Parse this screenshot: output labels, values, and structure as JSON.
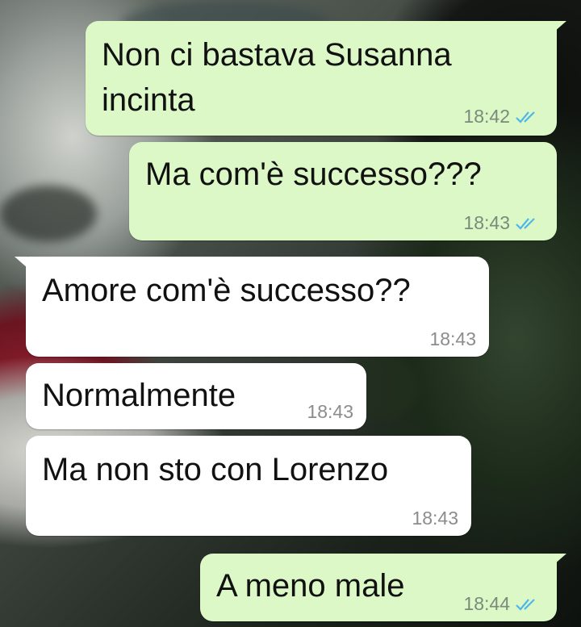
{
  "chat": {
    "messages": [
      {
        "direction": "outgoing",
        "text": "Non ci bastava Susanna\nincinta",
        "time": "18:42",
        "status_icon": "double-check-read-icon"
      },
      {
        "direction": "outgoing",
        "text": "Ma com'è successo???",
        "time": "18:43",
        "status_icon": "double-check-read-icon"
      },
      {
        "direction": "incoming",
        "text": "Amore com'è successo??",
        "time": "18:43"
      },
      {
        "direction": "incoming",
        "text": "Normalmente",
        "time": "18:43"
      },
      {
        "direction": "incoming",
        "text": "Ma non sto con Lorenzo",
        "time": "18:43"
      },
      {
        "direction": "outgoing",
        "text": "A meno male",
        "time": "18:44",
        "status_icon": "double-check-read-icon"
      }
    ]
  },
  "colors": {
    "outgoing_bubble": "#dcf8c6",
    "incoming_bubble": "#ffffff",
    "read_ticks": "#4fb6ec"
  }
}
